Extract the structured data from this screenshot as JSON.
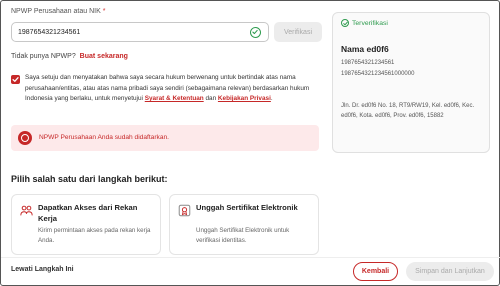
{
  "form": {
    "label": "NPWP Perusahaan atau NIK",
    "required_mark": "*",
    "npwp_value": "1987654321234561",
    "verify_button": "Verifikasi",
    "no_npwp_text": "Tidak punya NPWP?",
    "create_now_link": "Buat sekarang",
    "consent_text_1": "Saya setuju dan menyatakan bahwa saya secara hukum berwenang untuk bertindak atas nama perusahaan/entitas, atau atas nama pribadi saya sendiri (sebagaimana relevan) berdasarkan hukum Indonesia yang berlaku, untuk menyetujui",
    "terms_link": "Syarat & Ketentuan",
    "consent_and": "dan",
    "privacy_link": "Kebijakan Privasi",
    "consent_end": ".",
    "alert_text": "NPWP Perusahaan Anda sudah didaftarkan.",
    "colors": {
      "accent": "#c62828",
      "success": "#2e9b4e",
      "alert_bg": "#fde9ea"
    }
  },
  "side_card": {
    "status": "Terverifikasi",
    "name": "Nama ed0f6",
    "npwp": "1987654321234561",
    "npwp_full": "1987654321234561000000",
    "address": "Jln. Dr. ed0f6 No. 18, RT9/RW19, Kel. ed0f6, Kec. ed0f6, Kota. ed0f6, Prov. ed0f6, 15882"
  },
  "steps": {
    "title": "Pilih salah satu dari langkah berikut:",
    "cards": [
      {
        "icon": "people-icon",
        "title": "Dapatkan Akses dari Rekan Kerja",
        "desc": "Kirim permintaan akses pada rekan kerja Anda."
      },
      {
        "icon": "certificate-icon",
        "title": "Unggah Sertifikat Elektronik",
        "desc": "Unggah Sertifikat Elektronik untuk verifikasi identitas."
      }
    ]
  },
  "footer": {
    "skip": "Lewati Langkah Ini",
    "back": "Kembali",
    "save": "Simpan dan Lanjutkan"
  }
}
